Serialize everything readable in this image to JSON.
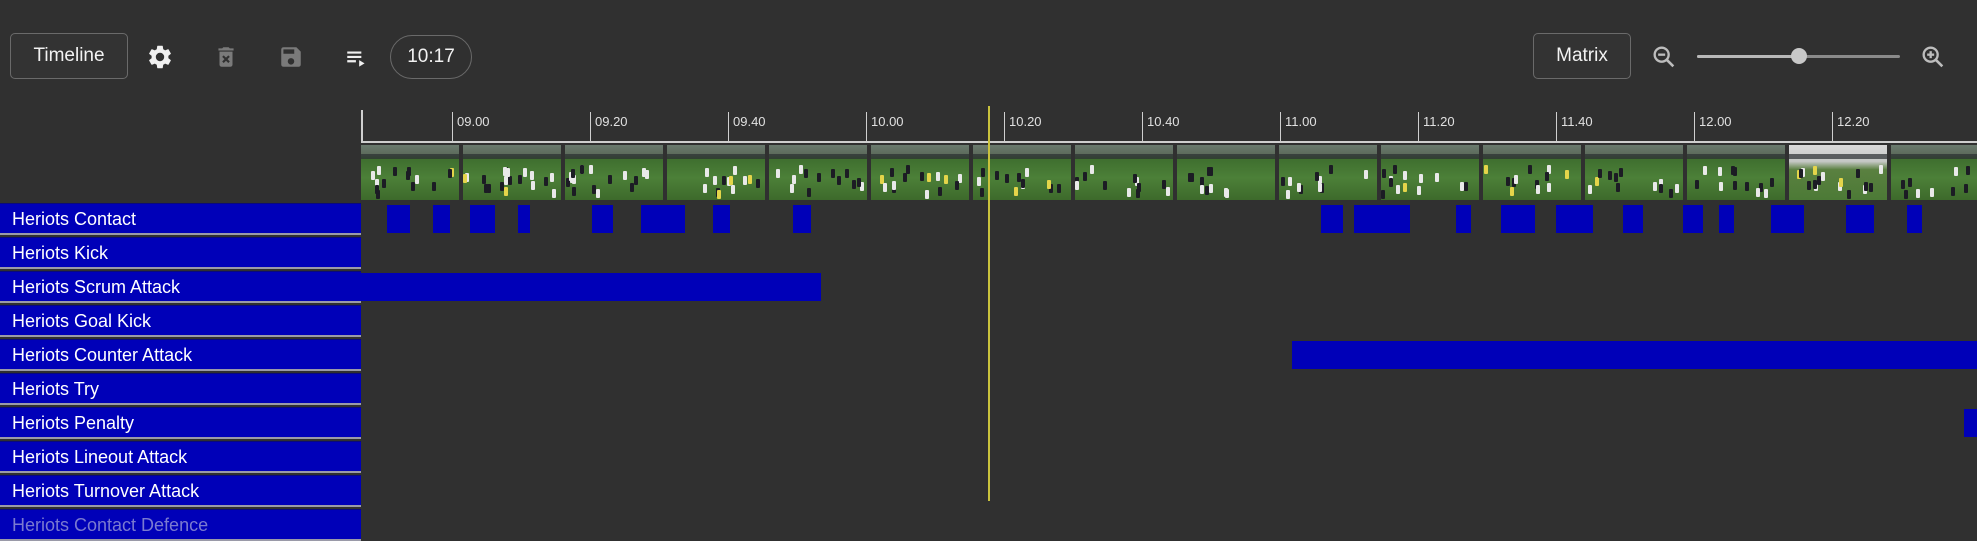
{
  "toolbar": {
    "timeline_label": "Timeline",
    "settings_icon": "gear-icon",
    "delete_icon": "trash-can-icon",
    "save_icon": "floppy-disk-icon",
    "playlist_icon": "playlist-play-icon",
    "time": "10:17",
    "matrix_label": "Matrix",
    "zoom_out_icon": "zoom-out-icon",
    "zoom_in_icon": "zoom-in-icon",
    "zoom_level": 0.5
  },
  "ruler": {
    "ticks": [
      "09.00",
      "09.20",
      "09.40",
      "10.00",
      "10.20",
      "10.40",
      "11.00",
      "11.20",
      "11.40",
      "12.00",
      "12.20"
    ]
  },
  "playhead": {
    "time": "10:17"
  },
  "rows": [
    {
      "label": "Heriots Contact"
    },
    {
      "label": "Heriots Kick"
    },
    {
      "label": "Heriots Scrum Attack"
    },
    {
      "label": "Heriots Goal Kick"
    },
    {
      "label": "Heriots Counter Attack"
    },
    {
      "label": "Heriots Try"
    },
    {
      "label": "Heriots Penalty"
    },
    {
      "label": "Heriots Lineout Attack"
    },
    {
      "label": "Heriots Turnover Attack"
    },
    {
      "label": "Heriots Contact Defence"
    }
  ],
  "colors": {
    "background": "#303030",
    "row_blue": "#0000b8",
    "playhead": "#c9c23c"
  }
}
